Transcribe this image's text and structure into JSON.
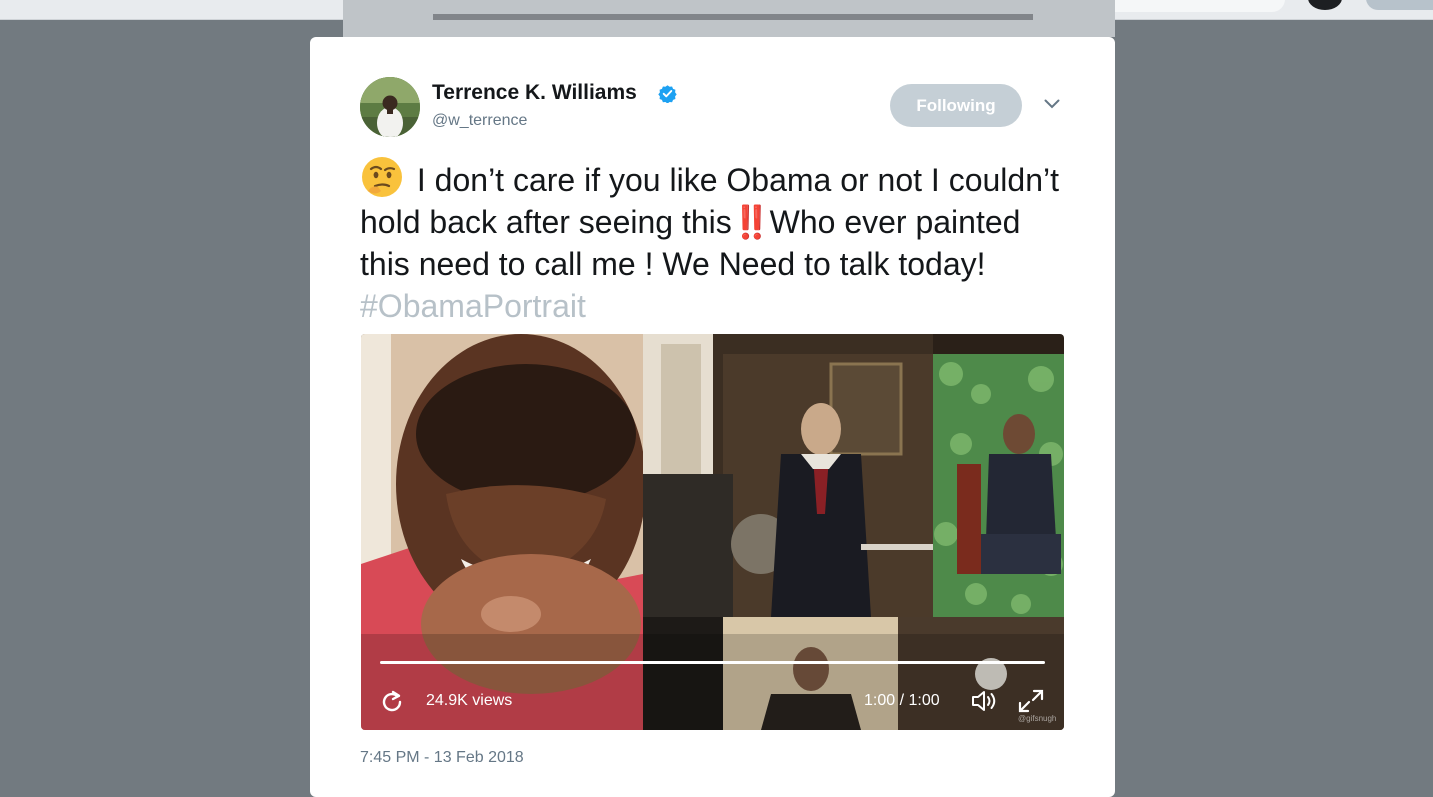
{
  "tweet": {
    "author_name": "Terrence K. Williams",
    "author_handle": "@w_terrence",
    "follow_button_label": "Following",
    "text_part1": " I don’t care if you like Obama or not I couldn’t hold back after seeing this",
    "emphasis_emoji": "‼️",
    "text_part2": "Who ever painted this need to call me ! We Need to talk today! ",
    "hashtag": "#ObamaPortrait",
    "timestamp": "7:45 PM - 13 Feb 2018"
  },
  "video": {
    "views": "24.9K views",
    "time": "1:00 / 1:00",
    "progress": 1.0,
    "watermark": "@gifsnugh"
  },
  "icons": {
    "verified": "verified-badge-icon",
    "caret": "chevron-down-icon",
    "replay": "replay-icon",
    "volume": "volume-icon",
    "fullscreen": "fullscreen-icon",
    "emoji": "thinking-face-emoji"
  },
  "colors": {
    "overlay": "#727a80",
    "verified_blue": "#1da1f2",
    "hashtag": "#b7c1c8",
    "following_button": "#c5cfd6",
    "handle_gray": "#657786"
  }
}
